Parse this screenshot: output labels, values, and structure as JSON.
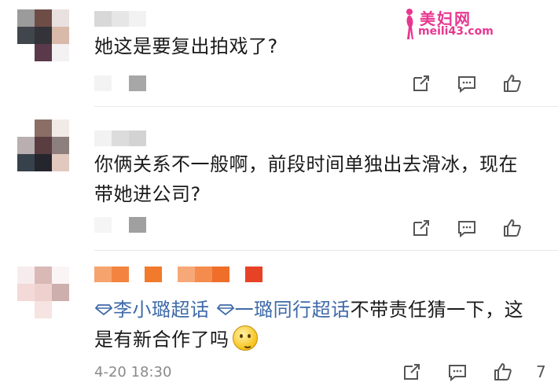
{
  "watermark": {
    "title": "美妇网",
    "url": "meili43.com"
  },
  "comments": [
    {
      "text": "她这是要复出拍戏了?",
      "meta_time": ""
    },
    {
      "text": "你俩关系不一般啊，前段时间单独出去滑冰，现在带她进公司?",
      "meta_time": ""
    },
    {
      "tags": [
        "李小璐超话",
        "一璐同行超话"
      ],
      "text": "不带责任猜一下，这是有新合作了吗",
      "meta_time": "4-20 18:30",
      "like_count": "7"
    }
  ],
  "icons": {
    "repost": "repost-icon",
    "comment": "comment-icon",
    "like": "thumbs-up-icon",
    "supertopic": "diamond-icon",
    "emoji": "thinking-emoji"
  },
  "colors": {
    "link": "#3f6aa8",
    "watermark": "#e8368f",
    "meta": "#8a8a8a"
  }
}
